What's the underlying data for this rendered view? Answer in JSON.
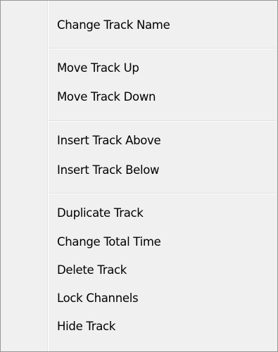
{
  "menu": {
    "items": [
      {
        "label": "Change Track Name"
      },
      {
        "label": "Move Track Up"
      },
      {
        "label": "Move Track Down"
      },
      {
        "label": "Insert Track Above"
      },
      {
        "label": "Insert Track Below"
      },
      {
        "label": "Duplicate Track"
      },
      {
        "label": "Change Total Time"
      },
      {
        "label": "Delete Track"
      },
      {
        "label": "Lock Channels"
      },
      {
        "label": "Hide Track"
      }
    ]
  },
  "colors": {
    "menu_background": "#f0f0f0",
    "border": "#979797",
    "separator": "#e0e0e0",
    "text": "#000000"
  }
}
